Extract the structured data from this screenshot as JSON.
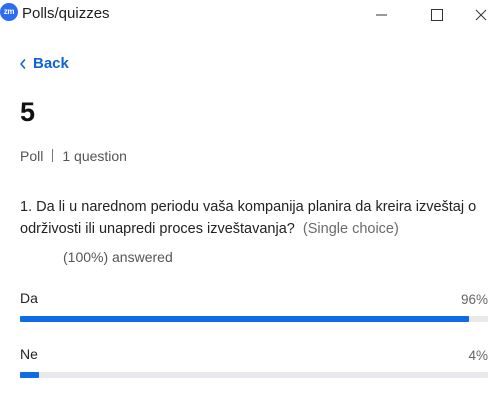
{
  "window": {
    "app_logo_text": "zm",
    "title": "Polls/quizzes"
  },
  "nav": {
    "back_label": "Back"
  },
  "poll": {
    "title": "5",
    "type": "Poll",
    "question_count": "1 question"
  },
  "question": {
    "text": "1. Da li u narednom periodu vaša kompanija planira da kreira izveštaj o održivosti ili unapredi proces izveštavanja?",
    "choice_type": "(Single choice)",
    "answered": "(100%) answered",
    "options": [
      {
        "label": "Da",
        "percent_text": "96%",
        "fraction": 0.96
      },
      {
        "label": "Ne",
        "percent_text": "4%",
        "fraction": 0.04
      }
    ]
  },
  "colors": {
    "accent": "#0e6be8",
    "link": "#0e63d6",
    "logo": "#2d6df6",
    "track": "#e9e9ed"
  },
  "icons": [
    "app-logo",
    "minimize-icon",
    "maximize-icon",
    "close-icon",
    "chevron-left-icon"
  ]
}
